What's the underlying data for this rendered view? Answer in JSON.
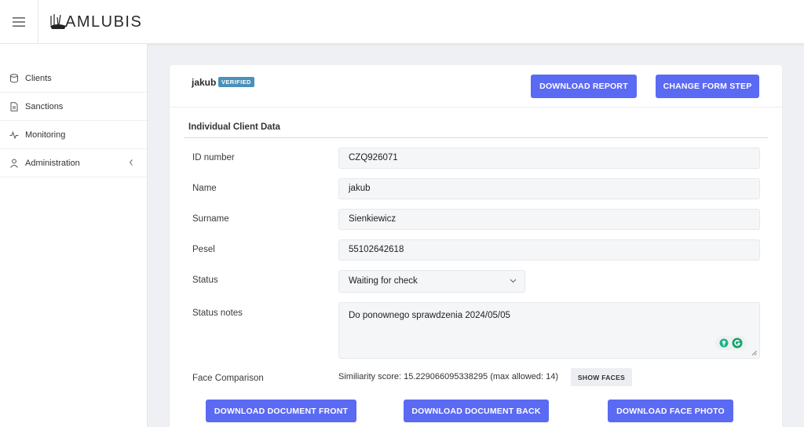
{
  "app": {
    "logo_text": "AMLUBIS"
  },
  "sidebar": {
    "items": [
      {
        "label": "Clients",
        "icon": "database-icon"
      },
      {
        "label": "Sanctions",
        "icon": "document-icon"
      },
      {
        "label": "Monitoring",
        "icon": "activity-icon"
      },
      {
        "label": "Administration",
        "icon": "user-icon",
        "has_submenu": true
      }
    ]
  },
  "client": {
    "name": "jakub",
    "badge": "VERIFIED"
  },
  "actions": {
    "download_report": "DOWNLOAD REPORT",
    "change_form_step": "CHANGE FORM STEP"
  },
  "section": {
    "title": "Individual Client Data"
  },
  "fields": {
    "id_number": {
      "label": "ID number",
      "value": "CZQ926071"
    },
    "name": {
      "label": "Name",
      "value": "jakub"
    },
    "surname": {
      "label": "Surname",
      "value": "Sienkiewicz"
    },
    "pesel": {
      "label": "Pesel",
      "value": "55102642618"
    },
    "status": {
      "label": "Status",
      "value": "Waiting for check"
    },
    "status_notes": {
      "label": "Status notes",
      "value": "Do ponownego sprawdzenia 2024/05/05"
    },
    "face_comparison": {
      "label": "Face Comparison",
      "text": "Similiarity score: 15.229066095338295 (max allowed: 14)",
      "show_faces": "SHOW FACES"
    }
  },
  "downloads": {
    "document_front": "DOWNLOAD DOCUMENT FRONT",
    "document_back": "DOWNLOAD DOCUMENT BACK",
    "face_photo": "DOWNLOAD FACE PHOTO"
  },
  "colors": {
    "primary": "#5b6af2",
    "badge": "#4a90b8",
    "background": "#eef0f3"
  }
}
